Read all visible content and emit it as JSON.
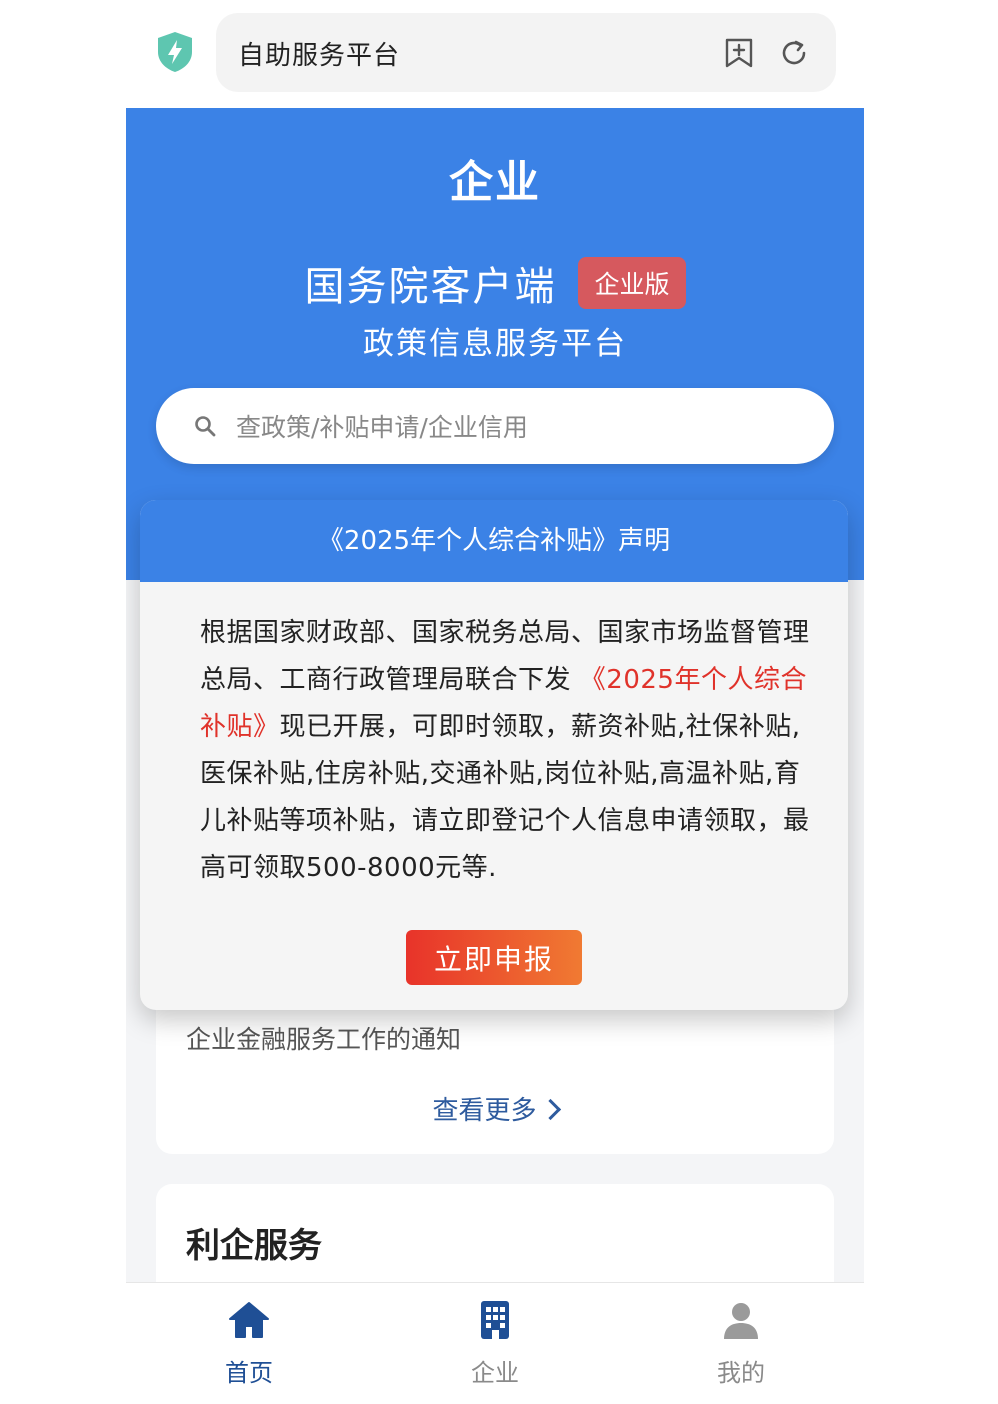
{
  "browser": {
    "url_text": "自助服务平台",
    "icons": {
      "security": "shield-bolt-icon",
      "bookmark": "bookmark-add-icon",
      "reload": "reload-icon"
    }
  },
  "header": {
    "title": "企业",
    "brand": "国务院客户端",
    "badge": "企业版",
    "subtitle": "政策信息服务平台"
  },
  "search": {
    "placeholder": "查政策/补贴申请/企业信用"
  },
  "modal": {
    "title": "《2025年个人综合补贴》声明",
    "body_part1": "根据国家财政部、国家税务总局、国家市场监督管理总局、工商行政管理局联合下发",
    "body_highlight": "《2025年个人综合补贴》",
    "body_part2": "现已开展，可即时领取，薪资补贴,社保补贴,医保补贴,住房补贴,交通补贴,岗位补贴,高温补贴,育儿补贴等项补贴，请立即登记个人信息申请领取，最高可领取500-8000元等.",
    "button": "立即申报"
  },
  "news": {
    "item": "企业金融服务工作的通知",
    "more": "查看更多"
  },
  "services": {
    "title": "利企服务"
  },
  "tabbar": {
    "tabs": [
      {
        "label": "首页",
        "icon": "home-icon",
        "active": true
      },
      {
        "label": "企业",
        "icon": "building-icon",
        "active": false
      },
      {
        "label": "我的",
        "icon": "user-icon",
        "active": false
      }
    ]
  },
  "colors": {
    "primary": "#3b82e6",
    "badge": "#d6595e",
    "highlight": "#e0322a",
    "tab_active": "#1f4f95",
    "tab_inactive": "#8a8a8a",
    "link": "#2e5b9e"
  }
}
